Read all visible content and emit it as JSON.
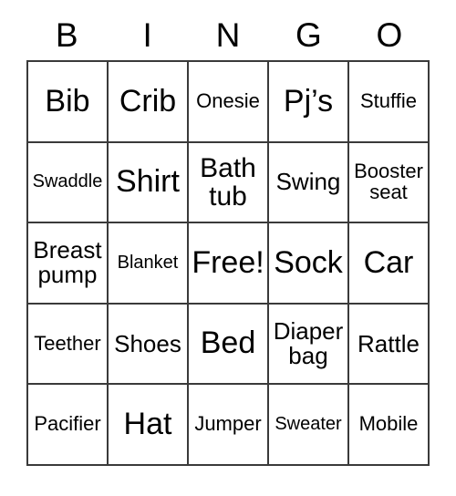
{
  "card": {
    "headers": [
      "B",
      "I",
      "N",
      "G",
      "O"
    ],
    "rows": [
      [
        {
          "label": "Bib",
          "size": "xl"
        },
        {
          "label": "Crib",
          "size": "xl"
        },
        {
          "label": "Onesie",
          "size": "sm"
        },
        {
          "label": "Pj’s",
          "size": "xl"
        },
        {
          "label": "Stuffie",
          "size": "sm"
        }
      ],
      [
        {
          "label": "Swaddle",
          "size": "xs"
        },
        {
          "label": "Shirt",
          "size": "xl"
        },
        {
          "label": "Bath tub",
          "size": "lg"
        },
        {
          "label": "Swing",
          "size": "md"
        },
        {
          "label": "Booster seat",
          "size": "sm"
        }
      ],
      [
        {
          "label": "Breast pump",
          "size": "md"
        },
        {
          "label": "Blanket",
          "size": "xs"
        },
        {
          "label": "Free!",
          "size": "xl"
        },
        {
          "label": "Sock",
          "size": "xl"
        },
        {
          "label": "Car",
          "size": "xl"
        }
      ],
      [
        {
          "label": "Teether",
          "size": "sm"
        },
        {
          "label": "Shoes",
          "size": "md"
        },
        {
          "label": "Bed",
          "size": "xl"
        },
        {
          "label": "Diaper bag",
          "size": "md"
        },
        {
          "label": "Rattle",
          "size": "md"
        }
      ],
      [
        {
          "label": "Pacifier",
          "size": "sm"
        },
        {
          "label": "Hat",
          "size": "xl"
        },
        {
          "label": "Jumper",
          "size": "sm"
        },
        {
          "label": "Sweater",
          "size": "xs"
        },
        {
          "label": "Mobile",
          "size": "sm"
        }
      ]
    ]
  },
  "colors": {
    "grid_line": "#3a3a3a",
    "text": "#000000",
    "background": "#ffffff"
  }
}
